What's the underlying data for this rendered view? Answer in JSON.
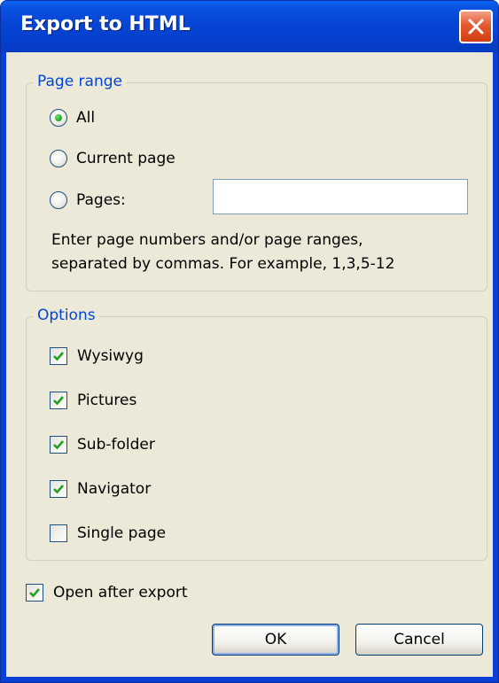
{
  "window": {
    "title": "Export to HTML",
    "close_icon": "close-icon"
  },
  "page_range": {
    "label": "Page range",
    "options": [
      {
        "label": "All",
        "selected": true
      },
      {
        "label": "Current page",
        "selected": false
      },
      {
        "label": "Pages:",
        "selected": false
      }
    ],
    "pages_input_value": "",
    "hint": "Enter page numbers and/or page ranges, separated by commas. For example, 1,3,5-12"
  },
  "options": {
    "label": "Options",
    "items": [
      {
        "label": "Wysiwyg",
        "checked": true
      },
      {
        "label": "Pictures",
        "checked": true
      },
      {
        "label": "Sub-folder",
        "checked": true
      },
      {
        "label": "Navigator",
        "checked": true
      },
      {
        "label": "Single page",
        "checked": false
      }
    ]
  },
  "open_after_export": {
    "label": "Open after export",
    "checked": true
  },
  "buttons": {
    "ok": "OK",
    "cancel": "Cancel"
  },
  "colors": {
    "title_bar": "#0846d6",
    "dialog_bg": "#ece9d8",
    "group_label": "#0046d5",
    "check_mark": "#21a121",
    "close_button": "#e4592f"
  }
}
